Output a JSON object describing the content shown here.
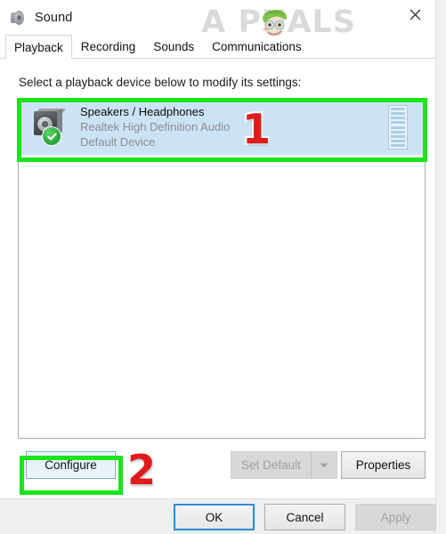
{
  "window": {
    "title": "Sound",
    "title_icon": "speaker-icon",
    "close_label": "✕"
  },
  "watermark": {
    "text": "A   PUALS",
    "mascot": "appuals-mascot-icon",
    "color": "#d9dadb"
  },
  "tabs": [
    {
      "label": "Playback",
      "active": true
    },
    {
      "label": "Recording",
      "active": false
    },
    {
      "label": "Sounds",
      "active": false
    },
    {
      "label": "Communications",
      "active": false
    }
  ],
  "main": {
    "prompt": "Select a playback device below to modify its settings:",
    "devices": [
      {
        "name": "Speakers / Headphones",
        "driver": "Realtek High Definition Audio",
        "status": "Default Device",
        "icon": "speaker-device-icon",
        "badge": "default-device-check-icon",
        "selected": true,
        "meter_segments": 9,
        "meter_level": 0
      }
    ]
  },
  "buttons": {
    "configure": {
      "label": "Configure",
      "enabled": true,
      "focused": true
    },
    "set_default": {
      "label": "Set Default",
      "enabled": false,
      "has_dropdown": true
    },
    "properties": {
      "label": "Properties",
      "enabled": true
    },
    "ok": {
      "label": "OK",
      "enabled": true,
      "is_default": true
    },
    "cancel": {
      "label": "Cancel",
      "enabled": true
    },
    "apply": {
      "label": "Apply",
      "enabled": false
    }
  },
  "annotations": {
    "highlight_color": "#19e619",
    "number_color": "#e01b1b",
    "steps": [
      {
        "number": "1",
        "target": "selected-playback-device"
      },
      {
        "number": "2",
        "target": "configure-button"
      }
    ]
  }
}
